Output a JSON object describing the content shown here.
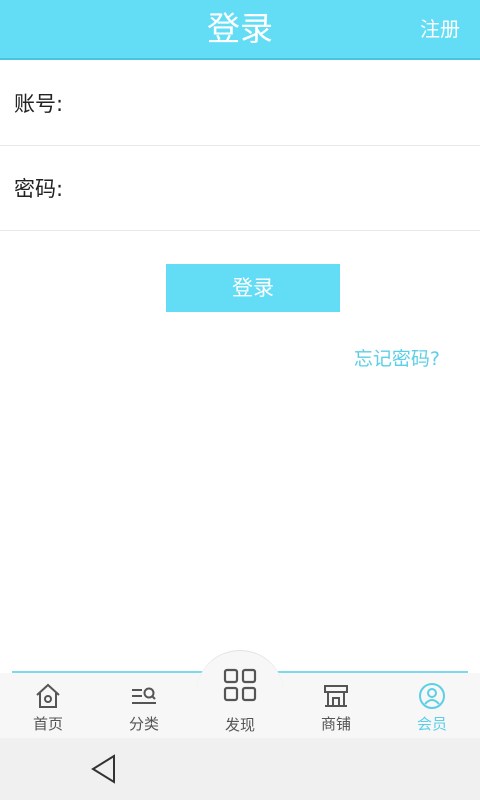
{
  "header": {
    "title": "登录",
    "register_label": "注册"
  },
  "form": {
    "account_label": "账号:",
    "password_label": "密码:",
    "login_button": "登录",
    "forgot_link": "忘记密码?"
  },
  "tabs": [
    {
      "label": "首页",
      "icon": "home-icon",
      "active": false
    },
    {
      "label": "分类",
      "icon": "category-icon",
      "active": false
    },
    {
      "label": "发现",
      "icon": "grid-icon",
      "active": false
    },
    {
      "label": "商铺",
      "icon": "store-icon",
      "active": false
    },
    {
      "label": "会员",
      "icon": "user-icon",
      "active": true
    }
  ],
  "colors": {
    "accent": "#62ddf5",
    "link": "#5ccfe6",
    "active_tab": "#5ccfe6"
  },
  "system_nav": {
    "icon": "back-icon"
  }
}
